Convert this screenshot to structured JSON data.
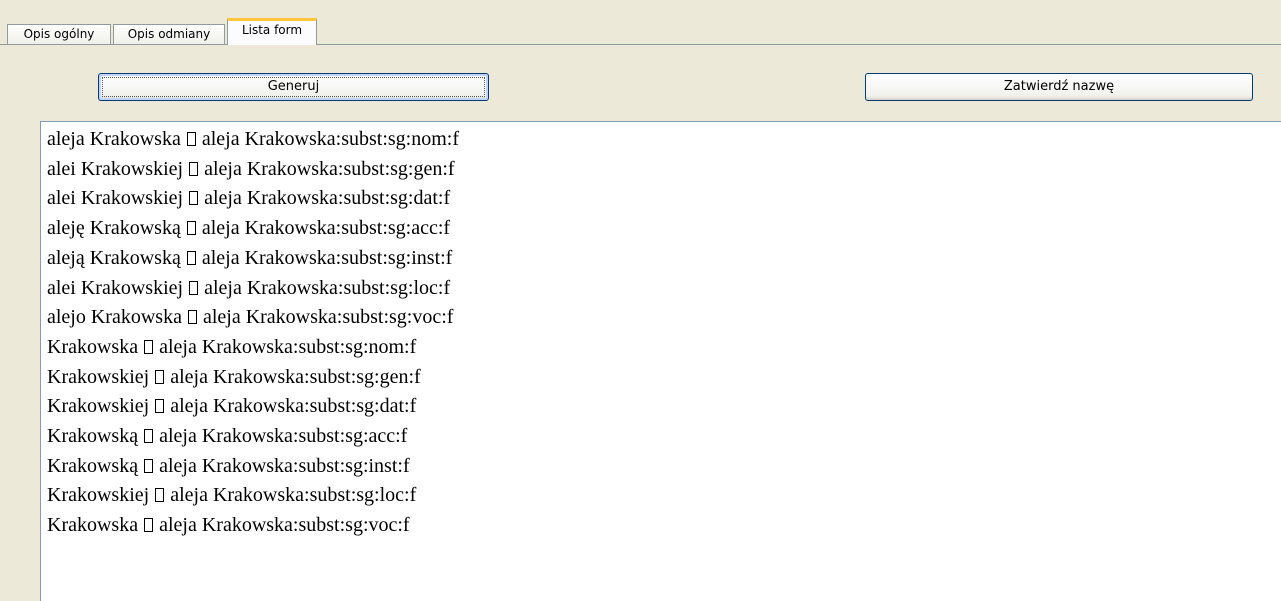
{
  "tabs": [
    {
      "label": "Opis ogólny",
      "active": false
    },
    {
      "label": "Opis odmiany",
      "active": false
    },
    {
      "label": "Lista form",
      "active": true
    }
  ],
  "buttons": {
    "generate_label": "Generuj",
    "confirm_label": "Zatwierdź nazwę"
  },
  "separator_glyph_icon": "missing-glyph-box-icon",
  "forms": [
    {
      "form": "aleja Krakowska",
      "tag": "aleja Krakowska:subst:sg:nom:f"
    },
    {
      "form": "alei Krakowskiej",
      "tag": "aleja Krakowska:subst:sg:gen:f"
    },
    {
      "form": "alei Krakowskiej",
      "tag": "aleja Krakowska:subst:sg:dat:f"
    },
    {
      "form": "aleję Krakowską",
      "tag": "aleja Krakowska:subst:sg:acc:f"
    },
    {
      "form": "aleją Krakowską",
      "tag": "aleja Krakowska:subst:sg:inst:f"
    },
    {
      "form": "alei Krakowskiej",
      "tag": "aleja Krakowska:subst:sg:loc:f"
    },
    {
      "form": "alejo Krakowska",
      "tag": "aleja Krakowska:subst:sg:voc:f"
    },
    {
      "form": "Krakowska",
      "tag": "aleja Krakowska:subst:sg:nom:f"
    },
    {
      "form": "Krakowskiej",
      "tag": "aleja Krakowska:subst:sg:gen:f"
    },
    {
      "form": "Krakowskiej",
      "tag": "aleja Krakowska:subst:sg:dat:f"
    },
    {
      "form": "Krakowską",
      "tag": "aleja Krakowska:subst:sg:acc:f"
    },
    {
      "form": "Krakowską",
      "tag": "aleja Krakowska:subst:sg:inst:f"
    },
    {
      "form": "Krakowskiej",
      "tag": "aleja Krakowska:subst:sg:loc:f"
    },
    {
      "form": "Krakowska",
      "tag": "aleja Krakowska:subst:sg:voc:f"
    }
  ]
}
